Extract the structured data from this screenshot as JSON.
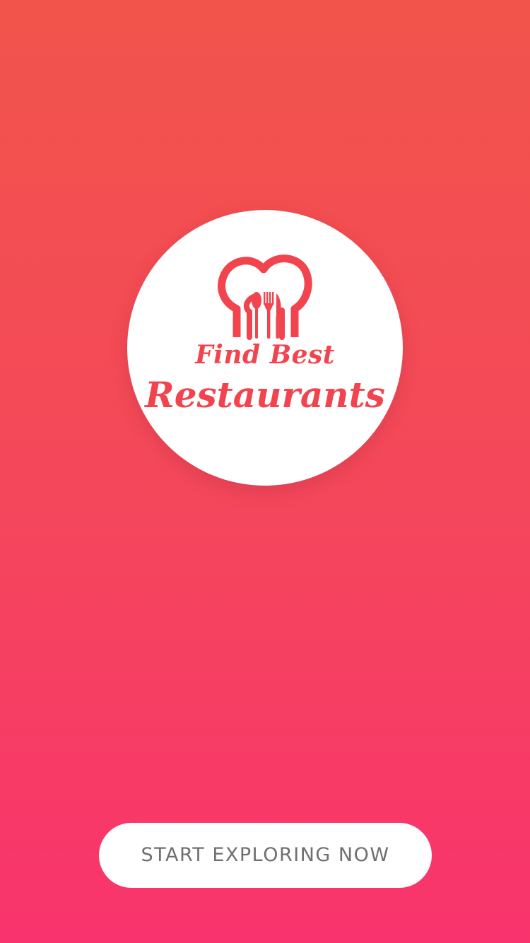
{
  "logo": {
    "line1": "Find Best",
    "line2": "Restaurants",
    "icon": "chef-hat-cutlery-icon",
    "color": "#f2444e"
  },
  "cta": {
    "label": "START EXPLORING NOW",
    "text_color": "#6f6f6f"
  },
  "colors": {
    "background_top": "#f2544b",
    "background_bottom": "#f9336d",
    "circle": "#ffffff"
  }
}
